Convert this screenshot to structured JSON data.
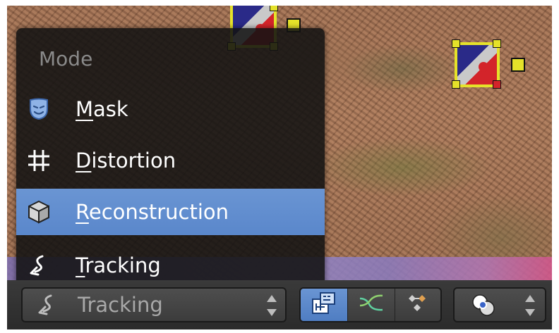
{
  "menu": {
    "title": "Mode",
    "items": [
      {
        "id": "mask",
        "first": "M",
        "rest": "ask",
        "icon": "mask-icon",
        "active": false
      },
      {
        "id": "distortion",
        "first": "D",
        "rest": "istortion",
        "icon": "grid-icon",
        "active": false
      },
      {
        "id": "reconstruction",
        "first": "R",
        "rest": "econstruction",
        "icon": "cube-icon",
        "active": true
      },
      {
        "id": "tracking",
        "first": "T",
        "rest": "racking",
        "icon": "tracking-icon",
        "active": false
      }
    ]
  },
  "header": {
    "mode_select": {
      "value": "Tracking",
      "icon": "tracking-icon"
    },
    "view_buttons": [
      {
        "icon": "clip-view-icon",
        "active": true
      },
      {
        "icon": "graph-view-icon",
        "active": false
      },
      {
        "icon": "dopesheet-view-icon",
        "active": false
      }
    ],
    "pivot_select": {
      "icon": "pivot-point-icon"
    }
  },
  "colors": {
    "menu_highlight": "#5a87cb",
    "marker_outline": "#e5e22a",
    "menu_bg": "#121212"
  }
}
